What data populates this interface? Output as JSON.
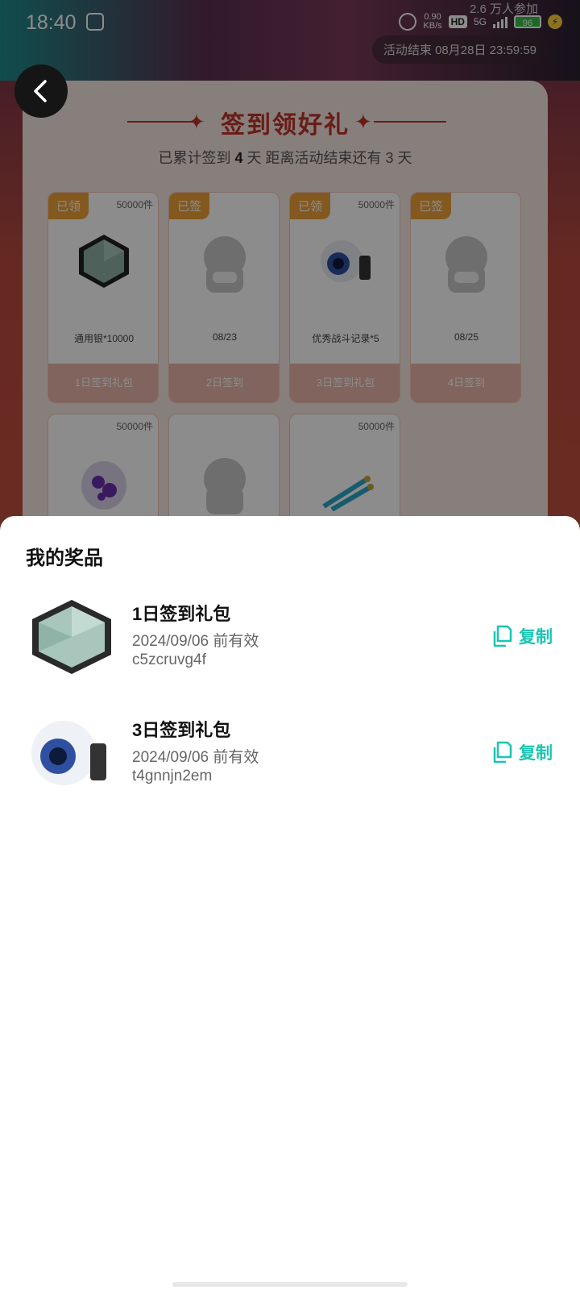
{
  "status": {
    "time": "18:40",
    "net_speed_value": "0.90",
    "net_speed_unit": "KB/s",
    "hd_label": "HD",
    "signal_label": "5G",
    "battery": "96"
  },
  "header": {
    "participants": "2.6 万人参加",
    "activity_end": "活动结束 08月28日 23:59:59"
  },
  "signin": {
    "title": "签到领好礼",
    "subtitle_prefix": "已累计签到",
    "signed_days": "4",
    "subtitle_mid": "天  距离活动结束还有 3 天",
    "cards": [
      {
        "tag": "已领",
        "count": "50000件",
        "name": "通用银*10000",
        "foot": "1日签到礼包"
      },
      {
        "tag": "已签",
        "count": "",
        "name": "08/23",
        "foot": "2日签到"
      },
      {
        "tag": "已领",
        "count": "50000件",
        "name": "优秀战斗记录*5",
        "foot": "3日签到礼包"
      },
      {
        "tag": "已签",
        "count": "",
        "name": "08/25",
        "foot": "4日签到"
      },
      {
        "tag": "",
        "count": "50000件",
        "name": "",
        "foot": ""
      },
      {
        "tag": "",
        "count": "",
        "name": "",
        "foot": ""
      },
      {
        "tag": "",
        "count": "50000件",
        "name": "",
        "foot": ""
      }
    ]
  },
  "prizes": {
    "title": "我的奖品",
    "items": [
      {
        "name": "1日签到礼包",
        "expiry": "2024/09/06 前有效",
        "code": "c5zcruvg4f",
        "copy_label": "复制"
      },
      {
        "name": "3日签到礼包",
        "expiry": "2024/09/06 前有效",
        "code": "t4gnnjn2em",
        "copy_label": "复制"
      }
    ]
  },
  "colors": {
    "accent": "#19c5b1",
    "title_red": "#c0342a",
    "tag_orange": "#f1a23a"
  }
}
